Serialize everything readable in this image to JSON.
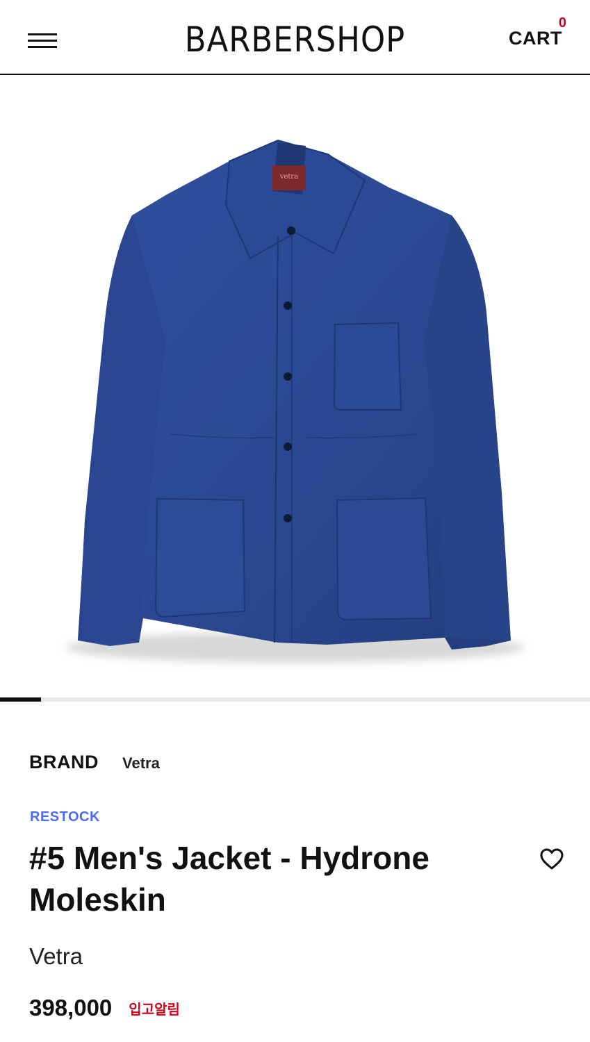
{
  "header": {
    "logo": "BARBERSHOP",
    "cart_label": "CART",
    "cart_count": "0",
    "menu_icon": "hamburger-menu-icon"
  },
  "gallery": {
    "image_subject": "navy-blue moleskin work jacket",
    "slide_progress": 0.07,
    "jacket_color": "#2c4a96"
  },
  "product": {
    "brand_label": "BRAND",
    "brand_name": "Vetra",
    "badge": "RESTOCK",
    "title": "#5 Men's Jacket - Hydrone Moleskin",
    "subtitle": "Vetra",
    "price": "398,000",
    "restock_alert": "입고알림",
    "wishlist_icon": "heart-outline-icon"
  },
  "colors": {
    "accent_red": "#d0021b",
    "badge_blue": "#4a6cf7"
  }
}
